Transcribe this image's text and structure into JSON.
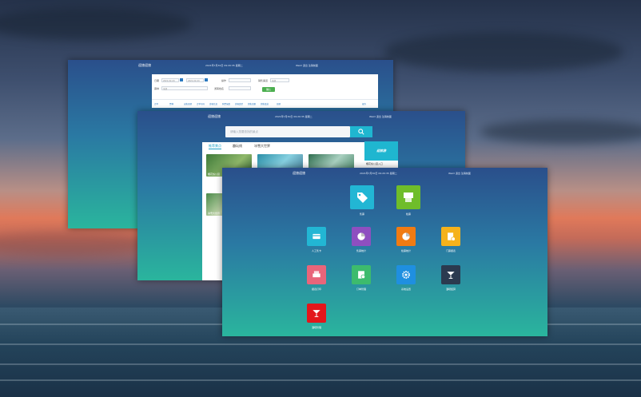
{
  "windows": {
    "query": {
      "title": "迎旅迎旅",
      "datetime": "2021年7月30日 09:20:35 星期二",
      "user": "Welcl 退出 注销前面",
      "fields": [
        {
          "label": "日期",
          "value": "2021-02-24"
        },
        {
          "label": "",
          "value": "2021-02-24"
        },
        {
          "label": "操作",
          "value": ""
        },
        {
          "label": "销售渠道",
          "value": "全部"
        },
        {
          "label": "票种",
          "value": "全部"
        },
        {
          "label": "游客姓名",
          "value": ""
        }
      ],
      "query_button": "确认",
      "table_headers": [
        "订单",
        "票种",
        "出售日期",
        "订单号码",
        "游客信息",
        "购票张数",
        "游客类型",
        "销售金额",
        "销售渠道",
        "日期",
        "操作"
      ]
    },
    "search": {
      "title": "迎旅迎旅",
      "datetime": "2021年7月30日 09:20:35 星期二",
      "user": "Welcl 退出 注销前面",
      "search_placeholder": "请输入您要查找的景点",
      "tabs": [
        "推荐景点",
        "趣玩线",
        "冰雪大世界"
      ],
      "cards": [
        "樱花谷公园",
        "冰雪大世界",
        "溪流谷",
        "冰雪大世界"
      ],
      "side_logo": "迎旅游",
      "side_caption": "樱花谷公园入口"
    },
    "dashboard": {
      "title": "迎旅迎旅",
      "datetime": "2021年7月30日 09:20:35 星期二",
      "user": "Welcl 退出 注销前面",
      "apps": [
        {
          "label": "售票",
          "color": "#22b6d4",
          "icon": "tag-icon"
        },
        {
          "label": "检票",
          "color": "#6fbd2a",
          "icon": "ticket-machine-icon"
        },
        {
          "label": "人工售卡",
          "color": "#22b6d4",
          "icon": "card-icon"
        },
        {
          "label": "售票统计",
          "color": "#8e4fc0",
          "icon": "pie-chart-icon"
        },
        {
          "label": "检票统计",
          "color": "#f07b13",
          "icon": "pie-chart-icon"
        },
        {
          "label": "门票报表",
          "color": "#f5b21b",
          "icon": "report-icon"
        },
        {
          "label": "报表打印",
          "color": "#e8657a",
          "icon": "printer-icon"
        },
        {
          "label": "订单管理",
          "color": "#3dbb6d",
          "icon": "order-icon"
        },
        {
          "label": "系统设置",
          "color": "#1f8fe0",
          "icon": "gear-icon"
        },
        {
          "label": "酒吧结算",
          "color": "#2b3a4f",
          "icon": "cocktail-icon"
        },
        {
          "label": "酒吧管理",
          "color": "#e3161b",
          "icon": "cocktail-icon"
        }
      ]
    }
  }
}
